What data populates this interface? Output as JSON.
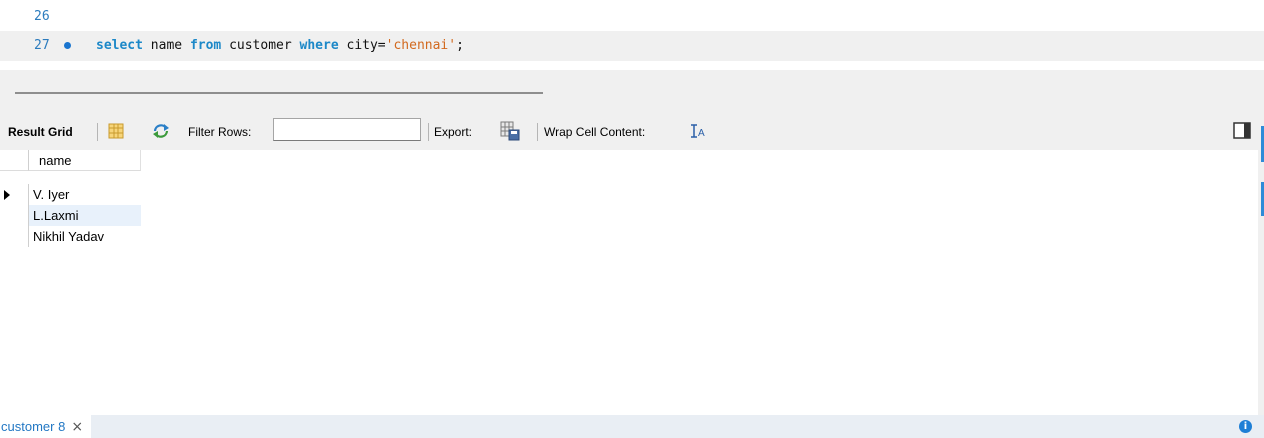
{
  "editor": {
    "lines": [
      {
        "number": "26",
        "code": ""
      },
      {
        "number": "27",
        "code_tokens": [
          {
            "text": "select",
            "type": "keyword"
          },
          {
            "text": " name ",
            "type": "plain"
          },
          {
            "text": "from",
            "type": "keyword"
          },
          {
            "text": " customer ",
            "type": "plain"
          },
          {
            "text": "where",
            "type": "keyword"
          },
          {
            "text": " city=",
            "type": "plain"
          },
          {
            "text": "'chennai'",
            "type": "string"
          },
          {
            "text": ";",
            "type": "plain"
          }
        ]
      }
    ]
  },
  "toolbar": {
    "result_grid_label": "Result Grid",
    "filter_rows_label": "Filter Rows:",
    "filter_rows_value": "",
    "export_label": "Export:",
    "wrap_label": "Wrap Cell Content:",
    "icons": {
      "grid_layout": "grid-layout-icon",
      "refresh": "refresh-icon",
      "export": "export-icon",
      "wrap": "wrap-cell-icon",
      "panel_toggle": "panel-toggle-icon"
    }
  },
  "grid": {
    "columns": [
      "name"
    ],
    "rows": [
      {
        "name": "V. Iyer",
        "current": true
      },
      {
        "name": "L.Laxmi",
        "selected": true
      },
      {
        "name": "Nikhil Yadav"
      }
    ]
  },
  "tabs": [
    {
      "label": "customer 8",
      "close": "×"
    }
  ],
  "status": {
    "info_icon": "i"
  },
  "colors": {
    "keyword": "#1c88c8",
    "string": "#d2691e",
    "line_number": "#2b7bbd",
    "tab_label": "#2378c4",
    "selection": "#e8f1fb"
  }
}
